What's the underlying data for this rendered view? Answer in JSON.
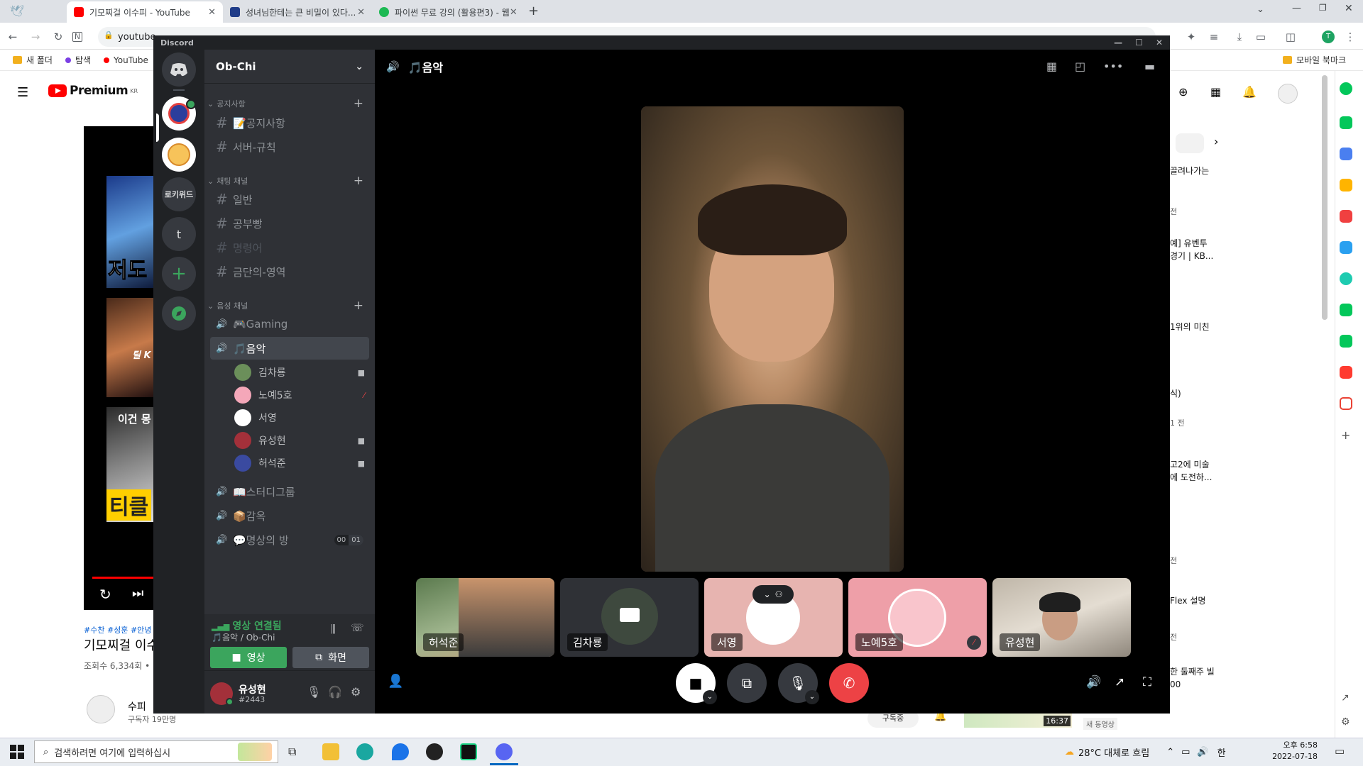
{
  "browser": {
    "tabs": [
      {
        "title": "기모찌걸 이수피 - YouTube",
        "color": "#ff0000"
      },
      {
        "title": "성녀님한테는 큰 비밀이 있다...",
        "color": "#1f3c88"
      },
      {
        "title": "파이썬 무료 강의 (활용편3) - 웹",
        "color": "#1db954"
      }
    ],
    "new_tab": "+",
    "url": "youtube",
    "bookmarks": [
      "새 폴더",
      "탐색",
      "YouTube"
    ],
    "mobile_bookmarks": "모바일 북마크"
  },
  "youtube": {
    "premium": "Premium",
    "region": "KR",
    "video_tags": "#수찬 #성훈 #안녕",
    "video_title": "기모찌걸 이수",
    "views": "조회수 6,334회 •",
    "channel": "수피",
    "subscribers": "구독자 19만명",
    "thumb_texts": [
      "저도",
      "틸 K",
      "이건 몽",
      "티클"
    ],
    "right_list": [
      "끌려나가는",
      "전",
      "예] 유벤투",
      "경기 | KB...",
      "1위의 미친",
      "식)",
      "1 전",
      "고2에 미술",
      "에 도전하...",
      "전",
      "Flex 설명",
      "전",
      "한 둘째주 빌",
      "00"
    ],
    "bottom_time": "16:37",
    "bottom_label": "새 동영상",
    "bottom_button": "구독중"
  },
  "discord": {
    "app_name": "Discord",
    "server_name": "Ob-Chi",
    "guilds": [
      "로키위드",
      "t"
    ],
    "categories": [
      "공지사항",
      "채팅 채널",
      "음성 채널"
    ],
    "text_channels_notice": [
      "📝공지사항",
      "서버-규칙"
    ],
    "text_channels_chat": [
      "일반",
      "공부빵",
      "명령어",
      "금단의-영역"
    ],
    "voice_channels": [
      "🎮Gaming",
      "🎵음악",
      "📖스터디그룹",
      "📦감옥",
      "💬명상의 방"
    ],
    "voice_users": [
      {
        "name": "김차룡",
        "icon": "camera-icon"
      },
      {
        "name": "노예5호",
        "icon": "mic-off-icon"
      },
      {
        "name": "서영",
        "icon": ""
      },
      {
        "name": "유성현",
        "icon": "camera-icon"
      },
      {
        "name": "허석준",
        "icon": "camera-icon"
      }
    ],
    "meditation_badges": [
      "00",
      "01"
    ],
    "voice_status": "영상 연결됨",
    "voice_location": "🎵음악 / Ob-Chi",
    "btn_video": "영상",
    "btn_screen": "화면",
    "user": {
      "name": "유성현",
      "tag": "#2443"
    },
    "main_channel": "🎵음악",
    "tiles": [
      "허석준",
      "김차룡",
      "서영",
      "노예5호",
      "유성현"
    ]
  },
  "taskbar": {
    "search_placeholder": "검색하려면 여기에 입력하십시",
    "weather": "28°C 대체로 흐림",
    "ime": "한",
    "time": "오후 6:58",
    "date": "2022-07-18"
  },
  "colors": {
    "discord_green": "#3ba55d",
    "discord_red": "#ed4245",
    "youtube_red": "#ff0000"
  }
}
